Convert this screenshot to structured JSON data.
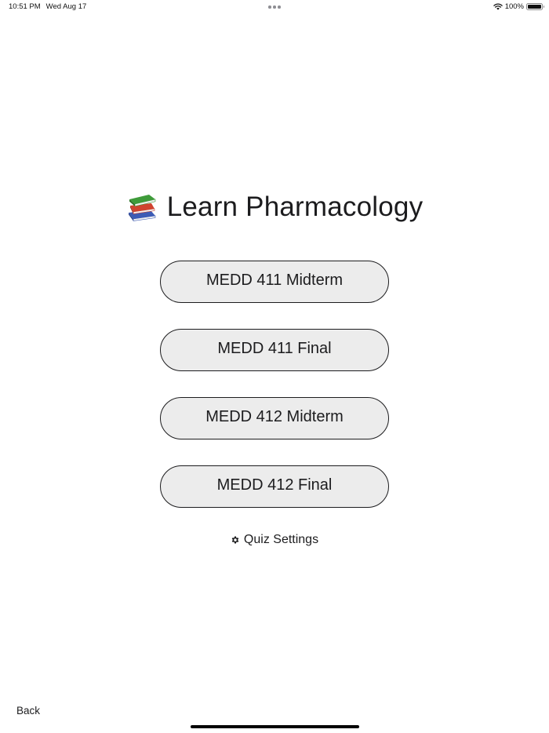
{
  "status_bar": {
    "time": "10:51 PM",
    "date": "Wed Aug 17",
    "battery_percent": "100%",
    "battery_level": 1.0,
    "icons": [
      "multitask-dots-icon",
      "wifi-icon",
      "battery-icon"
    ]
  },
  "header": {
    "icon": "books-icon",
    "title": "Learn Pharmacology"
  },
  "quizzes": [
    {
      "label": "MEDD 411 Midterm"
    },
    {
      "label": "MEDD 411 Final"
    },
    {
      "label": "MEDD 412 Midterm"
    },
    {
      "label": "MEDD 412 Final"
    }
  ],
  "settings": {
    "icon": "gear-icon",
    "label": "Quiz Settings"
  },
  "footer": {
    "back_label": "Back"
  },
  "colors": {
    "background": "#ffffff",
    "button_fill": "#ececec",
    "button_border": "#1c1c1e",
    "text": "#1c1c1e",
    "book_green": "#3e9b3a",
    "book_red": "#d0432f",
    "book_blue": "#3d5bb5"
  }
}
